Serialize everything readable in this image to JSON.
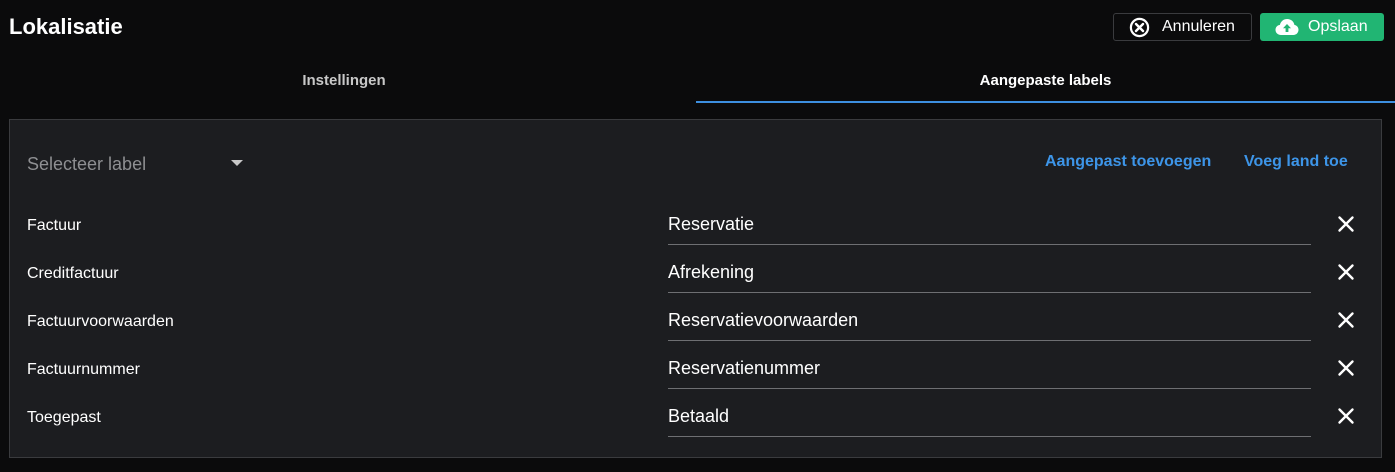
{
  "header": {
    "title": "Lokalisatie",
    "cancel_label": "Annuleren",
    "save_label": "Opslaan",
    "cancel_icon": "circle-x-icon",
    "save_icon": "cloud-upload-icon"
  },
  "tabs": [
    {
      "label": "Instellingen",
      "active": false
    },
    {
      "label": "Aangepaste labels",
      "active": true
    }
  ],
  "toolbar": {
    "select_placeholder": "Selecteer label",
    "add_custom_label": "Aangepast toevoegen",
    "add_country_label": "Voeg land toe"
  },
  "rows": [
    {
      "label": "Factuur",
      "value": "Reservatie"
    },
    {
      "label": "Creditfactuur",
      "value": "Afrekening"
    },
    {
      "label": "Factuurvoorwaarden",
      "value": "Reservatievoorwaarden"
    },
    {
      "label": "Factuurnummer",
      "value": "Reservatienummer"
    },
    {
      "label": "Toegepast",
      "value": "Betaald"
    }
  ],
  "colors": {
    "background": "#0b0b0c",
    "panel": "#1c1d20",
    "accent": "#3d8fe0",
    "save": "#21b573"
  }
}
